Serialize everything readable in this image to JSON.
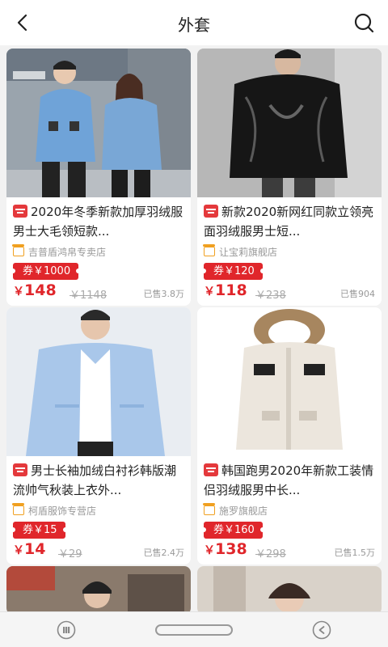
{
  "header": {
    "title": "外套",
    "back_icon": "back-chevron-icon",
    "search_icon": "search-icon"
  },
  "products": [
    {
      "title": "2020年冬季新款加厚羽绒服男士大毛领短款...",
      "shop": "吉普盾鸿帛专卖店",
      "coupon": "券￥1000",
      "price_symbol": "￥",
      "price": "148",
      "original": "￥1148",
      "sold": "已售3.8万"
    },
    {
      "title": "新款2020新网红同款立领亮面羽绒服男士短...",
      "shop": "让宝莉旗舰店",
      "coupon": "券￥120",
      "price_symbol": "￥",
      "price": "118",
      "original": "￥238",
      "sold": "已售904"
    },
    {
      "title": "男士长袖加绒白衬衫韩版潮流帅气秋装上衣外...",
      "shop": "柯盾服饰专营店",
      "coupon": "券￥15",
      "price_symbol": "￥",
      "price": "14",
      "original": "￥29",
      "sold": "已售2.4万"
    },
    {
      "title": "韩国跑男2020年新款工装情侣羽绒服男中长...",
      "shop": "施罗旗舰店",
      "coupon": "券￥160",
      "price_symbol": "￥",
      "price": "138",
      "original": "￥298",
      "sold": "已售1.5万"
    }
  ],
  "bottom_nav": {
    "left_icon": "nav-menu-icon",
    "center": "home-indicator",
    "right_icon": "nav-back-icon"
  },
  "colors": {
    "accent": "#e0262b",
    "page_bg": "#f2f2f2"
  }
}
